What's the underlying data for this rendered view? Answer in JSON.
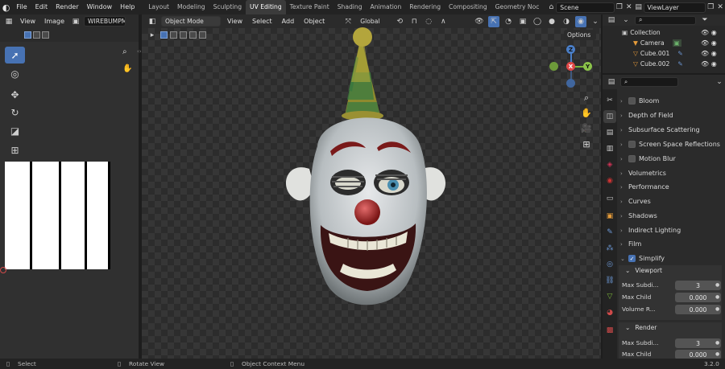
{
  "topbar": {
    "menu": [
      "File",
      "Edit",
      "Render",
      "Window",
      "Help"
    ],
    "workspaces": [
      "Layout",
      "Modeling",
      "Sculpting",
      "UV Editing",
      "Texture Paint",
      "Shading",
      "Animation",
      "Rendering",
      "Compositing",
      "Geometry Noc"
    ],
    "active_workspace": "UV Editing",
    "scene": "Scene",
    "view_layer": "ViewLayer"
  },
  "uv_editor": {
    "view_label": "View",
    "image_label": "Image",
    "image_name": "WIREBUMPMAP"
  },
  "viewport": {
    "mode": "Object Mode",
    "view_label": "View",
    "select_label": "Select",
    "add_label": "Add",
    "object_label": "Object",
    "orientation": "Global",
    "options_label": "Options",
    "gizmo": {
      "x": "X",
      "y": "Y",
      "z": "Z"
    }
  },
  "outliner": {
    "items": [
      {
        "name": "Collection"
      },
      {
        "name": "Camera"
      },
      {
        "name": "Cube.001"
      },
      {
        "name": "Cube.002"
      }
    ]
  },
  "properties": {
    "panels": [
      {
        "label": "Bloom",
        "checkbox": true,
        "checked": false
      },
      {
        "label": "Depth of Field",
        "checkbox": false
      },
      {
        "label": "Subsurface Scattering",
        "checkbox": false
      },
      {
        "label": "Screen Space Reflections",
        "checkbox": true,
        "checked": false
      },
      {
        "label": "Motion Blur",
        "checkbox": true,
        "checked": false
      },
      {
        "label": "Volumetrics",
        "checkbox": false
      },
      {
        "label": "Performance",
        "checkbox": false
      },
      {
        "label": "Curves",
        "checkbox": false
      },
      {
        "label": "Shadows",
        "checkbox": false
      },
      {
        "label": "Indirect Lighting",
        "checkbox": false
      },
      {
        "label": "Film",
        "checkbox": false
      },
      {
        "label": "Simplify",
        "checkbox": true,
        "checked": true
      }
    ],
    "simplify": {
      "viewport_label": "Viewport",
      "viewport_fields": [
        {
          "label": "Max Subdi...",
          "value": "3"
        },
        {
          "label": "Max Child",
          "value": "0.000"
        },
        {
          "label": "Volume R...",
          "value": "0.000"
        }
      ],
      "render_label": "Render",
      "render_fields": [
        {
          "label": "Max Subdi...",
          "value": "3"
        },
        {
          "label": "Max Child",
          "value": "0.000"
        }
      ]
    }
  },
  "statusbar": {
    "select": "Select",
    "rotate": "Rotate View",
    "context": "Object Context Menu",
    "version": "3.2.0"
  },
  "colors": {
    "accent": "#4772b3",
    "background": "#1d1d1d"
  }
}
